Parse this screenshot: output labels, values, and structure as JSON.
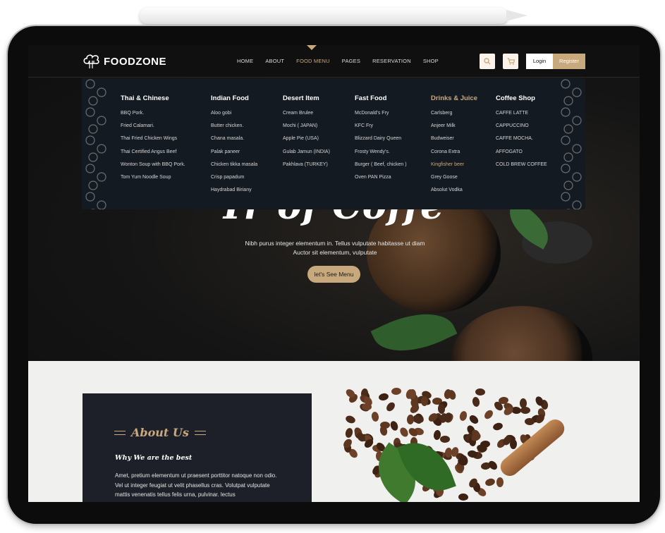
{
  "brand": {
    "name": "FOODZONE"
  },
  "nav": {
    "items": [
      "HOME",
      "ABOUT",
      "FOOD MENU",
      "PAGES",
      "RESERVATION",
      "SHOP"
    ],
    "active": "FOOD MENU",
    "login": "Login",
    "register": "Register",
    "icons": [
      "search-icon",
      "cart-icon"
    ]
  },
  "menu": {
    "columns": [
      {
        "title": "Thai & Chinese",
        "items": [
          "BBQ Pork.",
          "Fried Calamari.",
          "Thai Fried Chicken Wings",
          "Thai Certified Angus Beef",
          "Wonton Soup with BBQ Pork.",
          "Tom Yum Noodle Soup"
        ]
      },
      {
        "title": "Indian Food",
        "items": [
          "Aloo gobi",
          "Butter chicken.",
          "Chana masala.",
          "Palak paneer",
          "Chicken tikka masala",
          "Crisp papadum",
          "Haydrabad Biriany"
        ]
      },
      {
        "title": "Desert Item",
        "items": [
          "Cream Brulee",
          "Mochi ( JAPAN)",
          "Apple Pie (USA)",
          "Gulab Jamun (INDIA)",
          "Pakhlava (TURKEY)"
        ]
      },
      {
        "title": "Fast Food",
        "items": [
          "McDonald's Fry",
          "KFC Fry",
          "Blizzard Dairy Queen",
          "Frosty Wendy's.",
          "Burger ( Beef, chicken )",
          "Oven PAN Pizza"
        ]
      },
      {
        "title": "Drinks & Juice",
        "items": [
          "Carlsberg",
          "Anjeer Milk",
          "Budweiser",
          "Corona Extra",
          "Kingfisher beer",
          "Grey Goose",
          "Absolut Vodka"
        ],
        "highlight_item": "Kingfisher beer"
      },
      {
        "title": "Coffee Shop",
        "items": [
          "CAFFE LATTE",
          "CAPPUCCINO",
          "CAFFE MOCHA.",
          "AFFOGATO",
          "COLD BREW COFFEE"
        ]
      }
    ]
  },
  "hero": {
    "title": "Tr of Coffe",
    "text": "Nibh purus integer elementum in. Tellus vulputate habitasse ut diam Auctor sit elementum, vulputate",
    "button": "let's See Menu"
  },
  "about": {
    "title": "About Us",
    "subtitle": "Why We are the best",
    "text": "Amet, pretium elementum ut praesent porttitor natoque non odio. Vel ut integer feugiat ut velit phasellus cras. Volutpat vulputate mattis venenatis tellus felis urna, pulvinar. lectus"
  },
  "colors": {
    "accent": "#c8a97e",
    "menu_bg": "#141a22",
    "about_bg": "#1d2029"
  }
}
